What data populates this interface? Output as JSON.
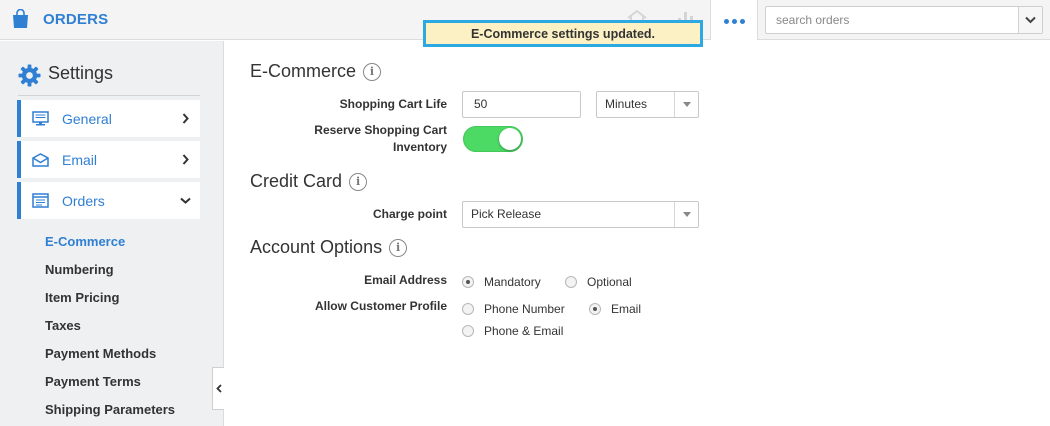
{
  "app": {
    "title": "ORDERS",
    "icon": "shopping-bag-icon"
  },
  "topbar": {
    "more_icon": "ellipsis-icon",
    "search": {
      "placeholder": "search orders",
      "value": ""
    }
  },
  "notification": {
    "message": "E-Commerce settings updated."
  },
  "sidebar": {
    "title": "Settings",
    "title_icon": "gear-icon",
    "items": [
      {
        "label": "General",
        "icon": "monitor-icon",
        "expanded": false
      },
      {
        "label": "Email",
        "icon": "envelope-icon",
        "expanded": false
      },
      {
        "label": "Orders",
        "icon": "window-list-icon",
        "expanded": true
      }
    ],
    "subitems": [
      {
        "label": "E-Commerce",
        "active": true
      },
      {
        "label": "Numbering",
        "active": false
      },
      {
        "label": "Item Pricing",
        "active": false
      },
      {
        "label": "Taxes",
        "active": false
      },
      {
        "label": "Payment Methods",
        "active": false
      },
      {
        "label": "Payment Terms",
        "active": false
      },
      {
        "label": "Shipping Parameters",
        "active": false
      }
    ]
  },
  "ecommerce": {
    "title": "E-Commerce",
    "cart_life_label": "Shopping Cart Life",
    "cart_life_value": "50",
    "cart_life_unit": "Minutes",
    "reserve_label_line1": "Reserve Shopping Cart",
    "reserve_label_line2": "Inventory",
    "reserve_enabled": true
  },
  "credit_card": {
    "title": "Credit Card",
    "charge_point_label": "Charge point",
    "charge_point_value": "Pick Release"
  },
  "account": {
    "title": "Account Options",
    "email_label": "Email Address",
    "email_options": [
      {
        "label": "Mandatory",
        "selected": true
      },
      {
        "label": "Optional",
        "selected": false
      }
    ],
    "profile_label": "Allow Customer Profile",
    "profile_options": [
      {
        "label": "Phone Number",
        "selected": false
      },
      {
        "label": "Email",
        "selected": true
      },
      {
        "label": "Phone & Email",
        "selected": false
      }
    ]
  },
  "colors": {
    "accent": "#2f7fd3",
    "toggle_on": "#4cd964",
    "toast_bg": "#fbf1c4",
    "toast_border": "#2ba9e0"
  }
}
